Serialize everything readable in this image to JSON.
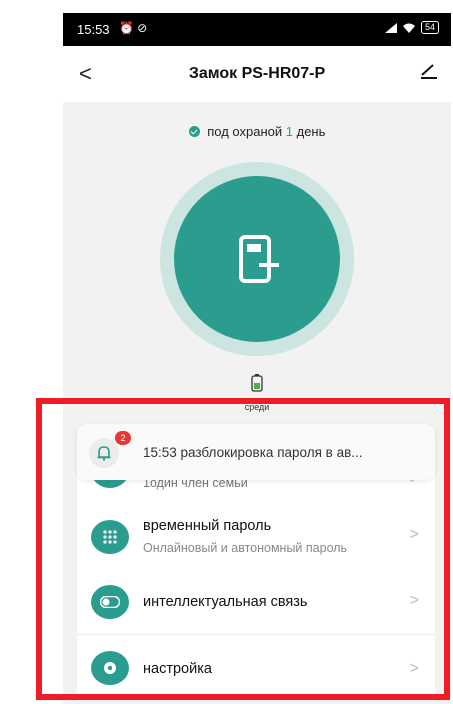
{
  "status_bar": {
    "time": "15:53",
    "status_icons": "⏰ ⊘",
    "battery": "54"
  },
  "nav": {
    "back_icon": "<",
    "title": "Замок PS-HR07-P",
    "edit_icon": "edit-icon"
  },
  "protection": {
    "prefix": "под охраной",
    "days": "1",
    "suffix": "день"
  },
  "lock": {
    "icon": "door-unlock-icon"
  },
  "battery_label": "среди",
  "notification": {
    "badge": "2",
    "text": "15:53 разблокировка пароля в ав..."
  },
  "rows": [
    {
      "title": "",
      "subtitle": "1один член семьи",
      "icon": "members-icon"
    },
    {
      "title": "временный пароль",
      "subtitle": "Онлайновый и автономный пароль",
      "icon": "keypad-icon"
    },
    {
      "title": "интеллектуальная связь",
      "subtitle": "",
      "icon": "toggle-icon"
    },
    {
      "title": "настройка",
      "subtitle": "",
      "icon": "gear-icon"
    }
  ],
  "chevron": ">",
  "colors": {
    "accent": "#2a9d8f",
    "accent_light": "#cce5e1",
    "badge": "#e53935",
    "highlight": "#ee1c25"
  }
}
